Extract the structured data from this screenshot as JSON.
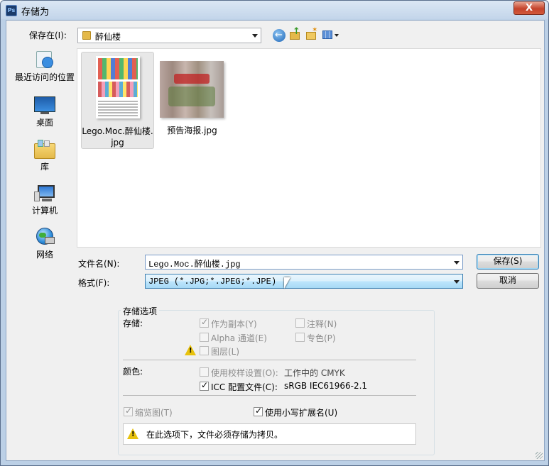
{
  "window": {
    "title": "存储为",
    "app_icon": "Ps",
    "close_label": "X"
  },
  "save_in": {
    "label": "保存在(I):",
    "folder": "醉仙楼"
  },
  "places": [
    {
      "label": "最近访问的位置",
      "icon": "recent-places-icon"
    },
    {
      "label": "桌面",
      "icon": "desktop-icon"
    },
    {
      "label": "库",
      "icon": "libraries-icon"
    },
    {
      "label": "计算机",
      "icon": "computer-icon"
    },
    {
      "label": "网络",
      "icon": "network-icon"
    }
  ],
  "files": [
    {
      "name_line1": "Lego.Moc.醉仙楼.",
      "name_line2": "jpg",
      "selected": true
    },
    {
      "name_line1": "预告海报.jpg",
      "name_line2": "",
      "selected": false
    }
  ],
  "filename": {
    "label": "文件名(N):",
    "value": "Lego.Moc.醉仙楼.jpg"
  },
  "format": {
    "label": "格式(F):",
    "value": "JPEG (*.JPG;*.JPEG;*.JPE)"
  },
  "buttons": {
    "save": "保存(S)",
    "cancel": "取消"
  },
  "options": {
    "title": "存储选项",
    "storage_label": "存储:",
    "as_copy": "作为副本(Y)",
    "notes": "注释(N)",
    "alpha": "Alpha 通道(E)",
    "spot": "专色(P)",
    "layers": "图层(L)",
    "color_label": "颜色:",
    "proof": "使用校样设置(O):",
    "proof_value": "工作中的 CMYK",
    "icc": "ICC 配置文件(C):",
    "icc_value": "sRGB IEC61966-2.1",
    "thumbnail": "缩览图(T)",
    "lowercase": "使用小写扩展名(U)",
    "warning": "在此选项下，文件必须存储为拷贝。"
  },
  "colors": {
    "accent": "#3c7fb1",
    "warning": "#e8c20d"
  }
}
